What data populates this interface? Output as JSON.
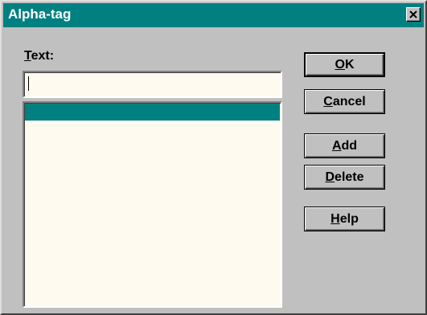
{
  "window": {
    "title": "Alpha-tag",
    "close_glyph": "✕"
  },
  "form": {
    "text_label": "Text:",
    "text_value": "",
    "list_items": [
      ""
    ]
  },
  "buttons": {
    "ok": "OK",
    "cancel": "Cancel",
    "add": "Add",
    "delete": "Delete",
    "help": "Help"
  },
  "colors": {
    "titlebar": "#008080",
    "selection": "#008080",
    "field_background": "#fffaf0",
    "face": "#c0c0c0"
  }
}
